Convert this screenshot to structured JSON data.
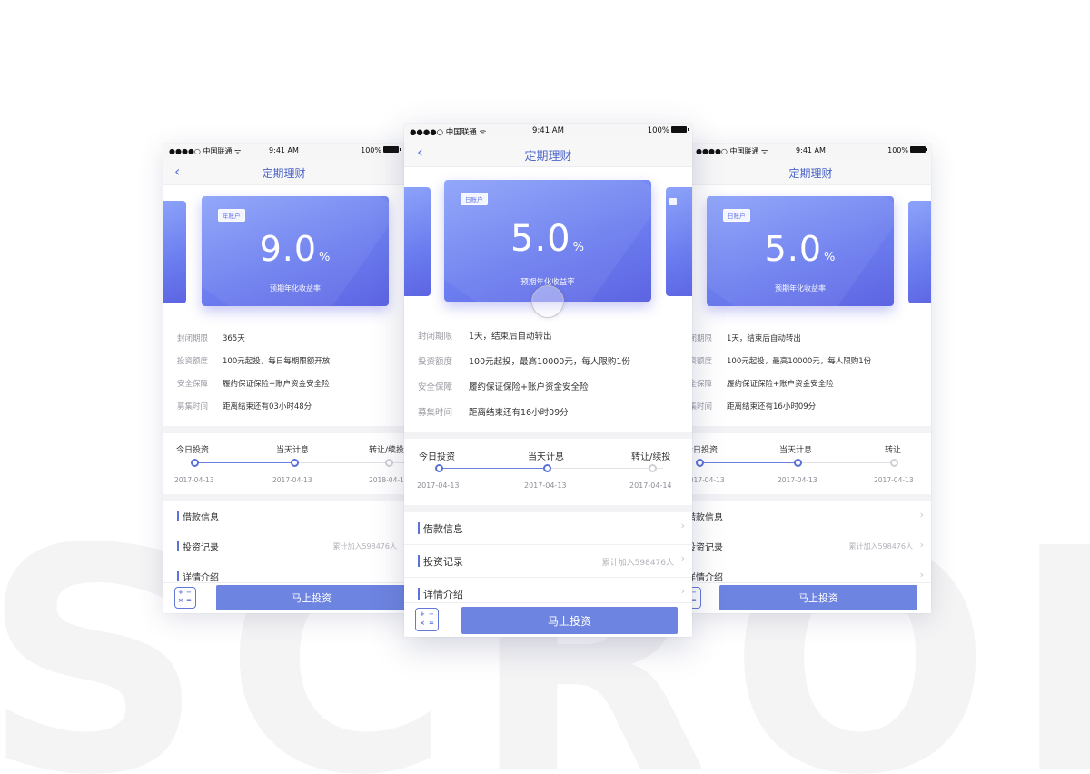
{
  "background_word": "SCROLL",
  "colors": {
    "accent": "#5b73d8",
    "card_start": "#8da3f9",
    "card_end": "#5d64e2",
    "button": "#6d84e0"
  },
  "left": {
    "status": {
      "carrier": "●●●●○ 中国联通 ᯤ",
      "time": "9:41 AM",
      "battery": "100%"
    },
    "nav_title": "定期理财",
    "card": {
      "tag": "年账户",
      "rate": "9.0",
      "unit": "%",
      "subtitle": "预期年化收益率"
    },
    "info": [
      {
        "label": "封闭期限",
        "value": "365天"
      },
      {
        "label": "投资额度",
        "value": "100元起投，每日每期限额开放"
      },
      {
        "label": "安全保障",
        "value": "履约保证保险+账户资金安全险"
      },
      {
        "label": "募集时间",
        "value": "距离结束还有03小时48分"
      }
    ],
    "timeline": {
      "stages": [
        "今日投资",
        "当天计息",
        "转让/续投"
      ],
      "dates": [
        "2017-04-13",
        "2017-04-13",
        "2018-04-13"
      ]
    },
    "list": [
      {
        "name": "借款信息",
        "meta": ""
      },
      {
        "name": "投资记录",
        "meta": "累计加入598476人"
      },
      {
        "name": "详情介绍",
        "meta": ""
      }
    ],
    "buy_label": "马上投资"
  },
  "center": {
    "status": {
      "carrier": "●●●●○ 中国联通 ᯤ",
      "time": "9:41 AM",
      "battery": "100%"
    },
    "nav_title": "定期理财",
    "card": {
      "tag": "日账户",
      "rate": "5.0",
      "unit": "%",
      "subtitle": "预期年化收益率"
    },
    "info": [
      {
        "label": "封闭期限",
        "value": "1天，结束后自动转出"
      },
      {
        "label": "投资额度",
        "value": "100元起投，最高10000元，每人限购1份"
      },
      {
        "label": "安全保障",
        "value": "履约保证保险+账户资金安全险"
      },
      {
        "label": "募集时间",
        "value": "距离结束还有16小时09分"
      }
    ],
    "timeline": {
      "stages": [
        "今日投资",
        "当天计息",
        "转让/续投"
      ],
      "dates": [
        "2017-04-13",
        "2017-04-13",
        "2017-04-14"
      ]
    },
    "list": [
      {
        "name": "借款信息",
        "meta": ""
      },
      {
        "name": "投资记录",
        "meta": "累计加入598476人"
      },
      {
        "name": "详情介绍",
        "meta": ""
      }
    ],
    "buy_label": "马上投资"
  },
  "right": {
    "status": {
      "carrier": "●●●●○ 中国联通 ᯤ",
      "time": "9:41 AM",
      "battery": "100%"
    },
    "nav_title": "定期理财",
    "card": {
      "tag": "日账户",
      "rate": "5.0",
      "unit": "%",
      "subtitle": "预期年化收益率"
    },
    "info": [
      {
        "label": "封闭期限",
        "value": "1天，结束后自动转出"
      },
      {
        "label": "投资额度",
        "value": "100元起投，最高10000元，每人限购1份"
      },
      {
        "label": "安全保障",
        "value": "履约保证保险+账户资金安全险"
      },
      {
        "label": "募集时间",
        "value": "距离结束还有16小时09分"
      }
    ],
    "timeline": {
      "stages": [
        "今日投资",
        "当天计息",
        "转让"
      ],
      "dates": [
        "2017-04-13",
        "2017-04-13",
        "2017-04-13"
      ]
    },
    "list": [
      {
        "name": "借款信息",
        "meta": ""
      },
      {
        "name": "投资记录",
        "meta": "累计加入598476人"
      },
      {
        "name": "详情介绍",
        "meta": ""
      }
    ],
    "buy_label": "马上投资"
  }
}
